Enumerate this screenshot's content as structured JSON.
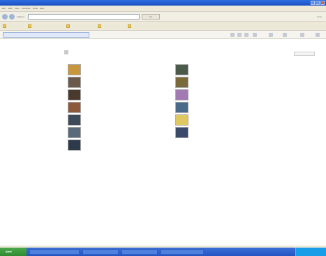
{
  "window": {
    "title": ""
  },
  "menu": {
    "items": [
      "File",
      "Edit",
      "View",
      "Favorites",
      "Tools",
      "Help"
    ]
  },
  "nav": {
    "address_label": "Address",
    "go_label": "Go",
    "links_label": "Links"
  },
  "tabs": [
    {
      "label": ""
    }
  ],
  "items": [
    {
      "label": "",
      "color": "#c8963c"
    },
    {
      "label": "",
      "color": "#6b5a4c"
    },
    {
      "label": "",
      "color": "#4a3a2e"
    },
    {
      "label": "",
      "color": "#8c5a3a"
    },
    {
      "label": "",
      "color": "#3c4a5a"
    },
    {
      "label": "",
      "color": "#5a6a7a"
    },
    {
      "label": "",
      "color": "#2c3a4a"
    },
    {
      "label": "",
      "color": "#4c5a4c"
    },
    {
      "label": "",
      "color": "#7a6a3a"
    },
    {
      "label": "",
      "color": "#a07ab0"
    },
    {
      "label": "",
      "color": "#4a6a8a"
    },
    {
      "label": "",
      "color": "#e0c860"
    },
    {
      "label": "",
      "color": "#3a4a6a"
    }
  ],
  "taskbar": {
    "start_label": "start",
    "tasks": [
      "",
      "",
      "",
      ""
    ],
    "clock": ""
  }
}
